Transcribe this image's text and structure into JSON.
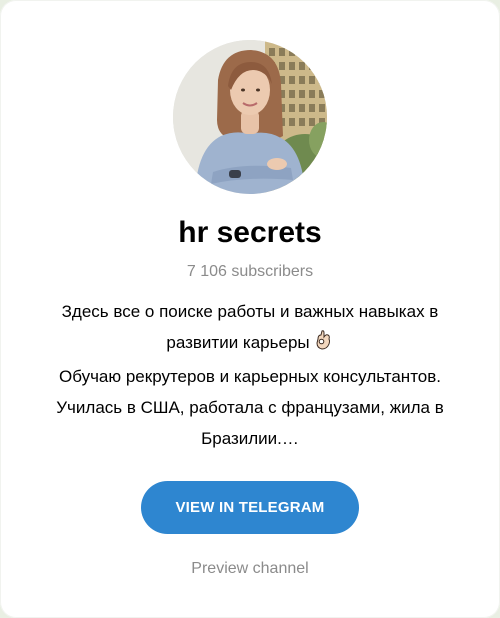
{
  "channel": {
    "title": "hr secrets",
    "subscribers": "7 106 subscribers",
    "description_lines": [
      "Здесь все о поиске работы и важных навыках в",
      "развитии карьеры",
      "Обучаю рекрутеров и карьерных консультантов.",
      "Училась в США, работала с французами, жила в",
      "Бразилии.…"
    ],
    "description_emoji": "ok-hand-emoji-icon"
  },
  "actions": {
    "view_label": "VIEW IN TELEGRAM",
    "preview_label": "Preview channel"
  },
  "colors": {
    "button": "#2e86d0",
    "muted_text": "#8b8b8b",
    "page_background": "#e9efe3"
  }
}
